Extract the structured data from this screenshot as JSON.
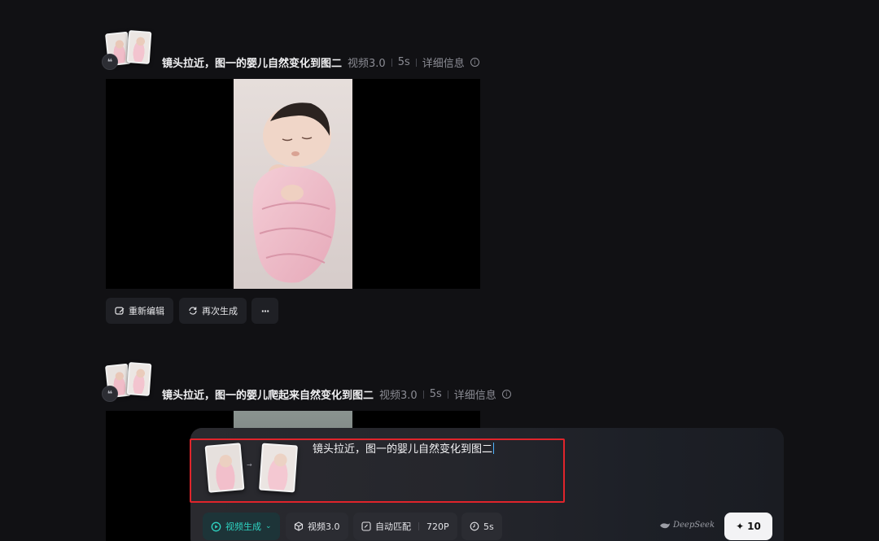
{
  "items": [
    {
      "prompt": "镜头拉近，图一的婴儿自然变化到图二",
      "model": "视频3.0",
      "duration": "5s",
      "details_label": "详细信息"
    },
    {
      "prompt": "镜头拉近，图一的婴儿爬起来自然变化到图二",
      "model": "视频3.0",
      "duration": "5s",
      "details_label": "详细信息"
    }
  ],
  "actions": {
    "reedit_label": "重新编辑",
    "regenerate_label": "再次生成",
    "more_label": "···"
  },
  "composer": {
    "prompt_value": "镜头拉近，图一的婴儿自然变化到图二",
    "mode_label": "视频生成",
    "model_label": "视频3.0",
    "ratio_label": "自动匹配",
    "resolution_label": "720P",
    "duration_label": "5s",
    "brand_label": "DeepSeek",
    "credits": "10"
  },
  "icons": {
    "quote": "quote-icon",
    "info": "info-icon",
    "edit": "edit-icon",
    "refresh": "refresh-icon",
    "more": "more-icon",
    "video-mode": "video-mode-icon",
    "cube": "cube-icon",
    "aspect": "aspect-ratio-icon",
    "clock": "clock-icon",
    "sparkle": "sparkle-icon"
  },
  "colors": {
    "background": "#111114",
    "accent": "#2ed3c1",
    "highlight": "#e0242b"
  }
}
